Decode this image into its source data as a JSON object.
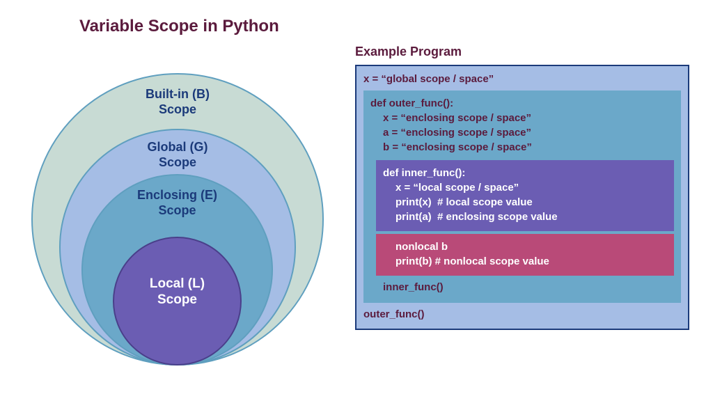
{
  "title": "Variable Scope in Python",
  "scopes": {
    "builtin": {
      "line1": "Built-in (B)",
      "line2": "Scope"
    },
    "global": {
      "line1": "Global (G)",
      "line2": "Scope"
    },
    "enclosing": {
      "line1": "Enclosing (E)",
      "line2": "Scope"
    },
    "local": {
      "line1": "Local (L)",
      "line2": "Scope"
    }
  },
  "example": {
    "title": "Example Program",
    "global_line": "x = “global scope / space”",
    "outer_def": "def outer_func():",
    "outer_x": "x = “enclosing scope / space”",
    "outer_a": "a = “enclosing scope / space”",
    "outer_b": "b = “enclosing scope / space”",
    "inner_def": "def inner_func():",
    "inner_x": "x = “local scope / space”",
    "inner_print_x": "print(x)  # local scope value",
    "inner_print_a": "print(a)  # enclosing scope value",
    "nonlocal_b": "nonlocal b",
    "print_b": "print(b) # nonlocal scope value",
    "inner_call": "inner_func()",
    "outer_call": "outer_func()"
  }
}
